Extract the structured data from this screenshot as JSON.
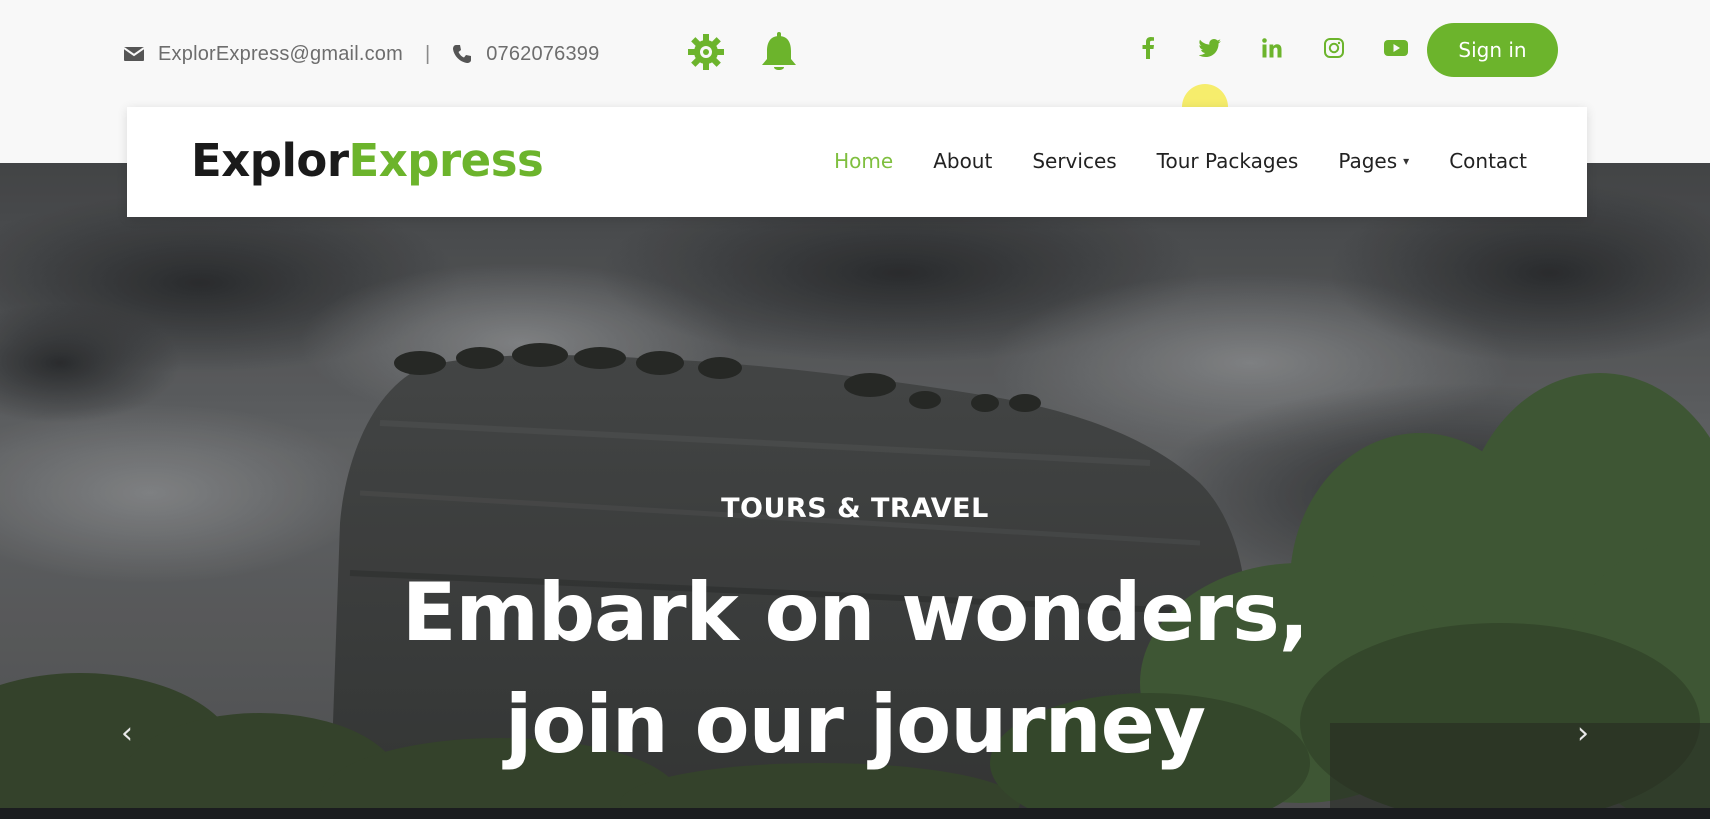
{
  "topbar": {
    "email": "ExplorExpress@gmail.com",
    "separator": "|",
    "phone": "0762076399",
    "icons": {
      "email": "envelope-icon",
      "phone": "phone-icon",
      "settings": "gear-icon",
      "notifications": "bell-icon"
    },
    "socials": [
      "facebook-icon",
      "twitter-icon",
      "linkedin-icon",
      "instagram-icon",
      "youtube-icon"
    ],
    "signin_label": "Sign in"
  },
  "navbar": {
    "brand_part1": "Explor",
    "brand_part2": "Express",
    "items": [
      {
        "label": "Home",
        "active": true
      },
      {
        "label": "About"
      },
      {
        "label": "Services"
      },
      {
        "label": "Tour Packages"
      },
      {
        "label": "Pages",
        "has_dropdown": true
      },
      {
        "label": "Contact"
      }
    ]
  },
  "hero": {
    "eyebrow": "TOURS & TRAVEL",
    "headline_line1": "Embark on wonders,",
    "headline_line2": "join our journey",
    "prev_glyph": "‹",
    "next_glyph": "›"
  },
  "colors": {
    "accent": "#6cb42c",
    "active_nav": "#7fbf3f",
    "text_dark": "#1a1a1a",
    "topbar_text": "#6d6d6d"
  }
}
